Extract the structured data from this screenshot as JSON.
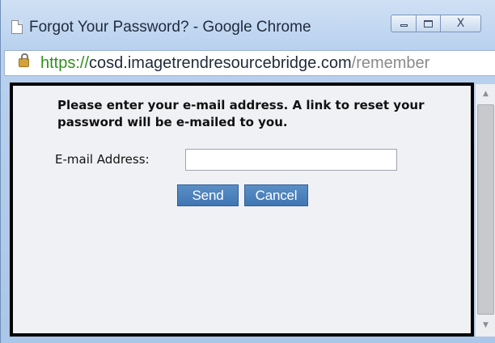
{
  "window": {
    "title": "Forgot Your Password? - Google Chrome",
    "close_glyph": "X"
  },
  "address_bar": {
    "scheme": "https://",
    "host": "cosd.imagetrendresourcebridge.com",
    "path": "/remember"
  },
  "form": {
    "message": "Please enter your e-mail address. A link to reset your password will be e-mailed to you.",
    "email_label": "E-mail Address:",
    "email_value": "",
    "email_placeholder": "",
    "send_label": "Send",
    "cancel_label": "Cancel"
  },
  "icons": {
    "page": "page-icon",
    "lock": "lock-icon",
    "minimize": "minimize-icon",
    "maximize": "maximize-icon",
    "close": "close-icon",
    "scroll_up": "scroll-up-icon",
    "scroll_down": "scroll-down-icon"
  },
  "colors": {
    "button": "#4a80bb",
    "url_secure": "#2f8f1f",
    "frame_border": "#000000"
  }
}
